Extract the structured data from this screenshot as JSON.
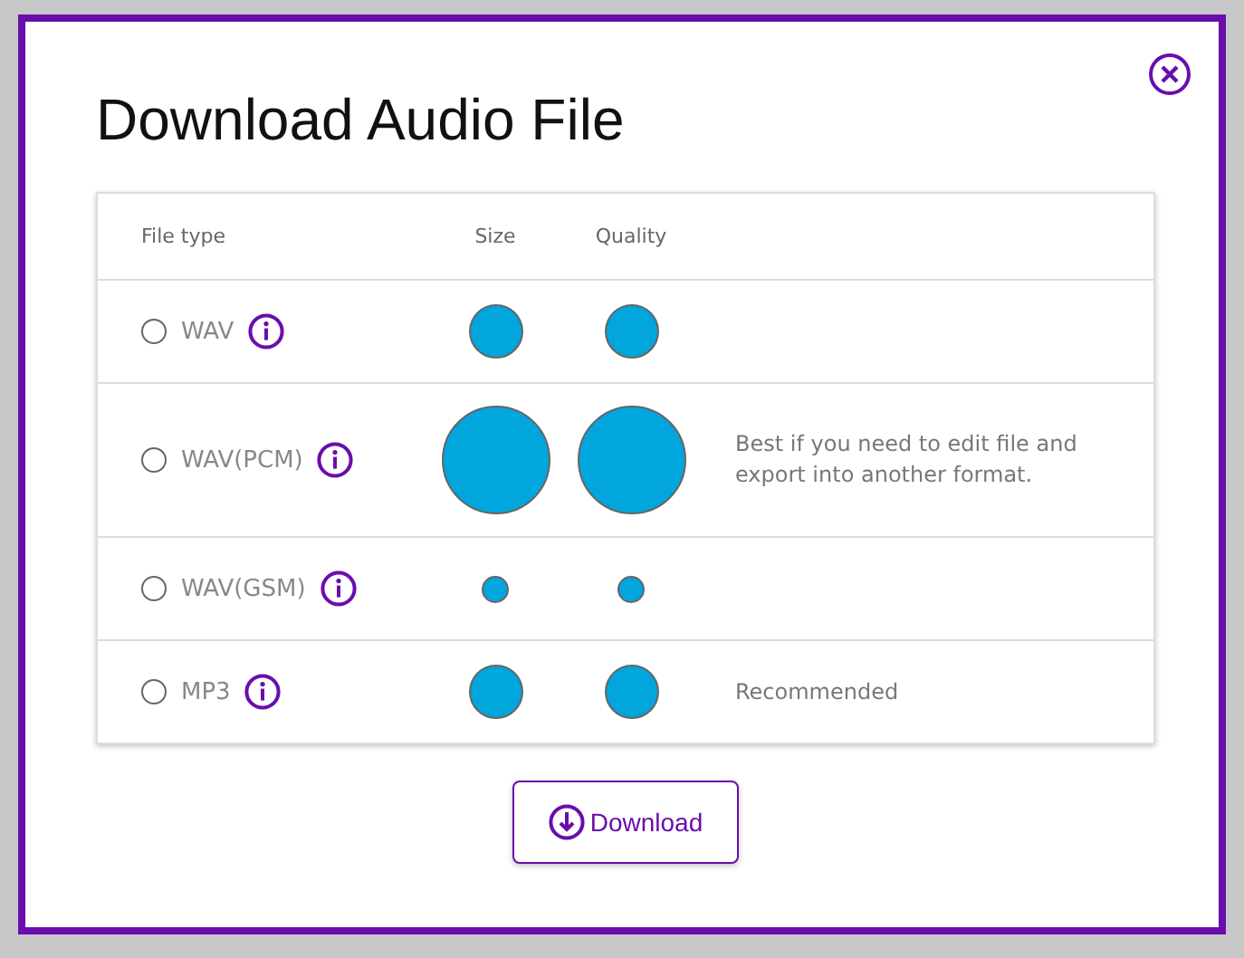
{
  "dialog": {
    "title": "Download Audio File"
  },
  "table": {
    "columns": [
      "File type",
      "Size",
      "Quality"
    ],
    "rows": [
      {
        "name": "WAV",
        "selected": false,
        "size": {
          "kind": "medium"
        },
        "quality": {
          "kind": "medium"
        }
      },
      {
        "name": "WAV(PCM)",
        "selected": false,
        "size": {
          "kind": "large"
        },
        "quality": {
          "kind": "large"
        },
        "note": "Best if you need to edit file and export into another format."
      },
      {
        "name": "WAV(GSM)",
        "selected": false,
        "size": {
          "kind": "small"
        },
        "quality": {
          "kind": "small"
        }
      },
      {
        "name": "MP3",
        "selected": false,
        "size": {
          "kind": "medium"
        },
        "quality": {
          "kind": "medium"
        },
        "note": "Recommended"
      }
    ]
  },
  "button": {
    "label": "Download"
  }
}
